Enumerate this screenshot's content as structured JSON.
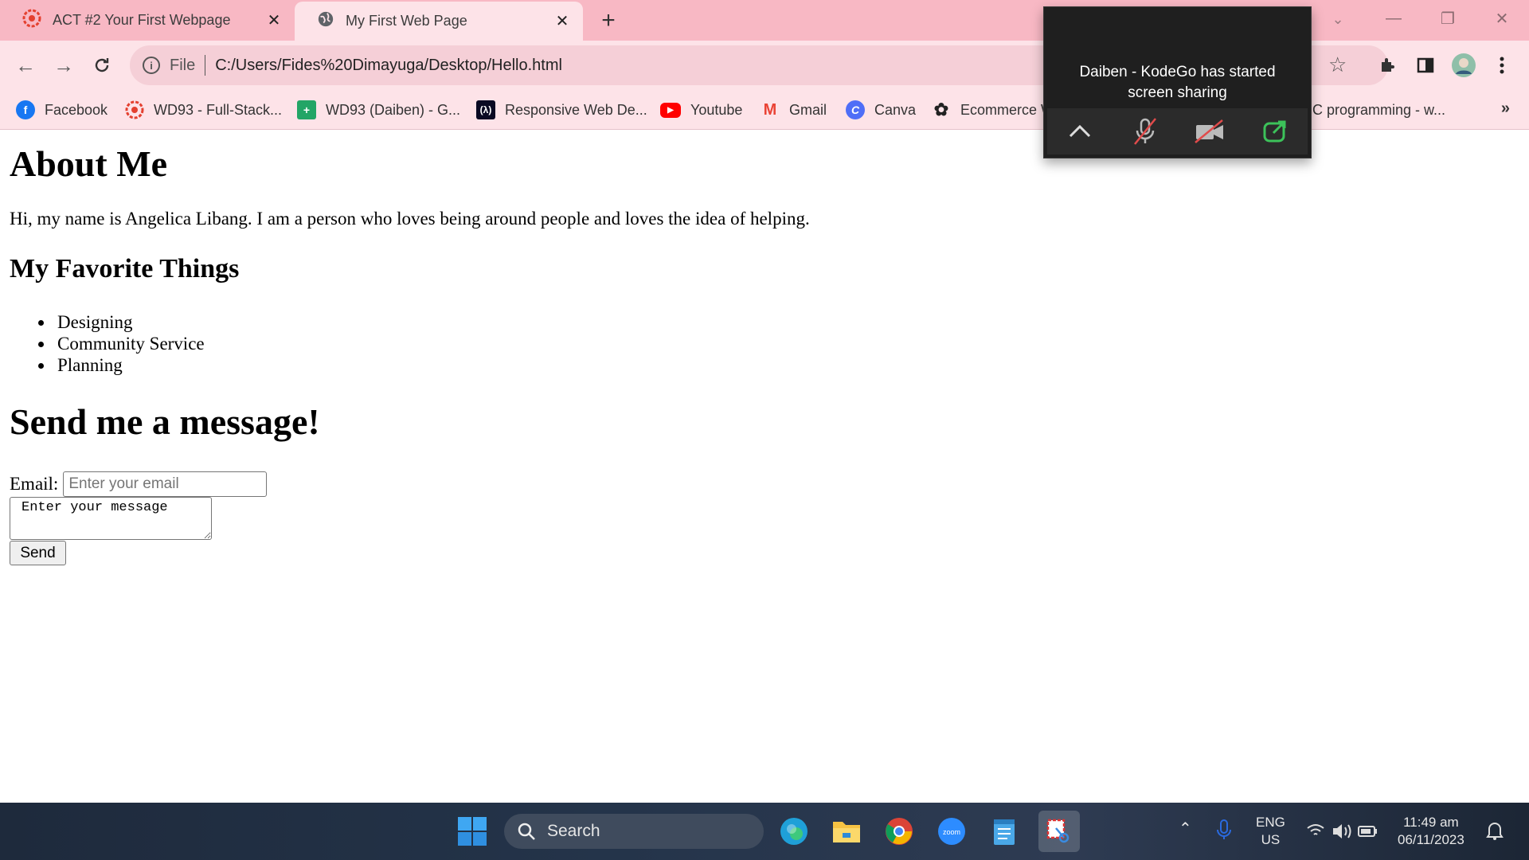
{
  "tabs": [
    {
      "title": "ACT #2 Your First Webpage",
      "icon": "kodego-icon"
    },
    {
      "title": "My First Web Page",
      "icon": "globe-icon"
    }
  ],
  "address": {
    "scheme": "File",
    "url": "C:/Users/Fides%20Dimayuga/Desktop/Hello.html"
  },
  "bookmarks": [
    {
      "label": "Facebook",
      "icon": "facebook-icon",
      "color": "#1877f2"
    },
    {
      "label": "WD93 - Full-Stack...",
      "icon": "kodego-icon",
      "color": "#e4402f"
    },
    {
      "label": "WD93 (Daiben) - G...",
      "icon": "sheets-icon",
      "color": "#23a566"
    },
    {
      "label": "Responsive Web De...",
      "icon": "freecodecamp-icon",
      "color": "#0a0a23"
    },
    {
      "label": "Youtube",
      "icon": "youtube-icon",
      "color": "#ff0000"
    },
    {
      "label": "Gmail",
      "icon": "gmail-icon",
      "color": "#ea4335"
    },
    {
      "label": "Canva",
      "icon": "canva-icon",
      "color": "#4f6ef7"
    },
    {
      "label": "Ecommerce W",
      "icon": "openai-icon",
      "color": "#222222"
    },
    {
      "label": "C programming - w...",
      "icon": "page-icon",
      "color": "#888888"
    }
  ],
  "content": {
    "heading": "About Me",
    "intro": "Hi, my name is Angelica Libang. I am a person who loves being around people and loves the idea of helping.",
    "favorites_heading": "My Favorite Things",
    "favorites": [
      "Designing",
      "Community Service",
      "Planning"
    ],
    "message_heading": "Send me a message!",
    "email_label": "Email:",
    "email_placeholder": "Enter your email",
    "message_placeholder": "Enter your message",
    "send_label": "Send"
  },
  "share_popup": {
    "text_line1": "Daiben - KodeGo has started",
    "text_line2": "screen sharing"
  },
  "taskbar": {
    "search_label": "Search",
    "lang_line1": "ENG",
    "lang_line2": "US",
    "time": "11:49 am",
    "date": "06/11/2023"
  },
  "colors": {
    "tabstrip": "#f8b8c4",
    "toolbar": "#fde3e8",
    "accent_red": "#e4402f"
  }
}
